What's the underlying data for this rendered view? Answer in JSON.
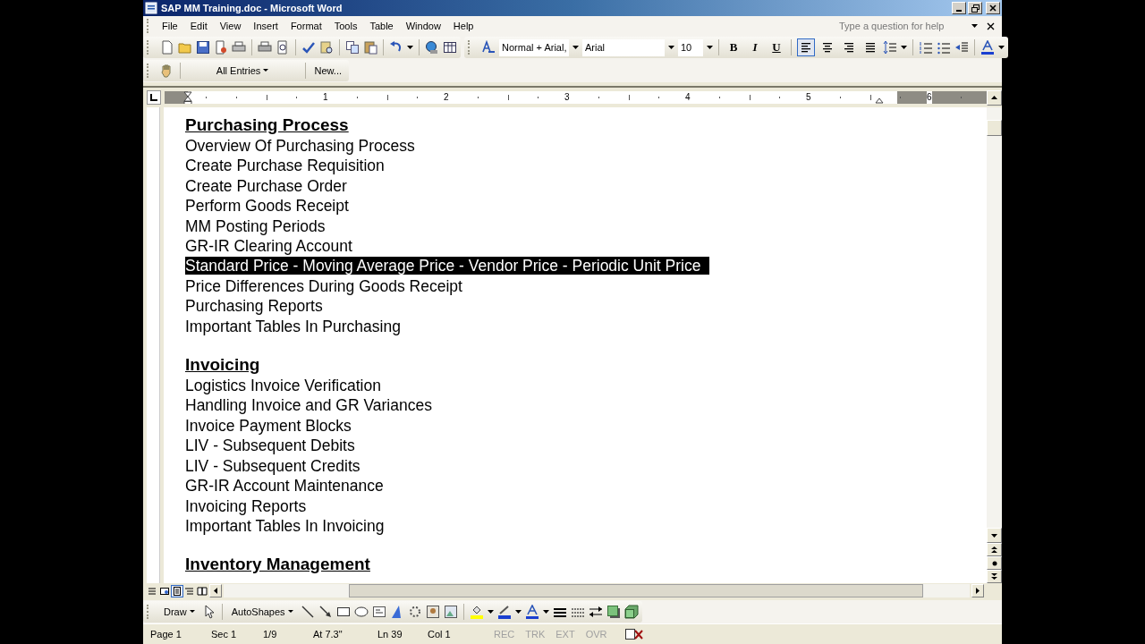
{
  "window": {
    "title": "SAP MM Training.doc - Microsoft Word"
  },
  "menu": [
    "File",
    "Edit",
    "View",
    "Insert",
    "Format",
    "Tools",
    "Table",
    "Window",
    "Help"
  ],
  "help_box": {
    "placeholder": "Type a question for help"
  },
  "formatting": {
    "style": "Normal + Arial,",
    "font": "Arial",
    "size": "10",
    "text_buttons": [
      {
        "label": "B",
        "kind": "bold",
        "selected": false
      },
      {
        "label": "I",
        "kind": "italic",
        "selected": false
      },
      {
        "label": "U",
        "kind": "underline",
        "selected": false
      }
    ],
    "align_buttons": [
      {
        "kind": "left",
        "selected": true
      },
      {
        "kind": "center",
        "selected": false
      },
      {
        "kind": "right",
        "selected": false
      },
      {
        "kind": "justify",
        "selected": false
      }
    ]
  },
  "autotext_toolbar": {
    "entries": "All Entries",
    "new_button": "New..."
  },
  "ruler": {
    "numbers": [
      "1",
      "2",
      "3",
      "4",
      "5",
      "6"
    ]
  },
  "document": {
    "sections": [
      {
        "heading": "Purchasing Process",
        "items": [
          {
            "text": "Overview Of Purchasing Process",
            "selected": false
          },
          {
            "text": "Create Purchase Requisition",
            "selected": false
          },
          {
            "text": "Create Purchase Order",
            "selected": false
          },
          {
            "text": "Perform Goods Receipt",
            "selected": false
          },
          {
            "text": "MM Posting Periods",
            "selected": false
          },
          {
            "text": "GR-IR Clearing Account",
            "selected": false
          },
          {
            "text": "Standard Price - Moving Average Price - Vendor Price - Periodic Unit Price",
            "selected": true
          },
          {
            "text": "Price Differences During Goods Receipt",
            "selected": false
          },
          {
            "text": "Purchasing Reports",
            "selected": false
          },
          {
            "text": "Important Tables In Purchasing",
            "selected": false
          }
        ]
      },
      {
        "heading": "Invoicing",
        "items": [
          {
            "text": "Logistics Invoice Verification",
            "selected": false
          },
          {
            "text": "Handling Invoice and GR Variances",
            "selected": false
          },
          {
            "text": "Invoice Payment Blocks",
            "selected": false
          },
          {
            "text": "LIV - Subsequent Debits",
            "selected": false
          },
          {
            "text": "LIV - Subsequent Credits",
            "selected": false
          },
          {
            "text": "GR-IR Account Maintenance",
            "selected": false
          },
          {
            "text": "Invoicing Reports",
            "selected": false
          },
          {
            "text": "Important Tables In Invoicing",
            "selected": false
          }
        ]
      },
      {
        "heading": "Inventory Management"
      }
    ]
  },
  "drawing_toolbar": {
    "draw_menu": "Draw",
    "autoshapes_menu": "AutoShapes"
  },
  "status_bar": {
    "fields": [
      {
        "text": "Page 1",
        "disabled": false
      },
      {
        "text": "Sec 1",
        "disabled": false
      },
      {
        "text": "1/9",
        "disabled": false
      },
      {
        "text": "At 7.3\"",
        "disabled": false
      },
      {
        "text": "Ln 39",
        "disabled": false
      },
      {
        "text": "Col 1",
        "disabled": false
      }
    ],
    "modes": [
      {
        "text": "REC",
        "disabled": true
      },
      {
        "text": "TRK",
        "disabled": true
      },
      {
        "text": "EXT",
        "disabled": true
      },
      {
        "text": "OVR",
        "disabled": true
      }
    ]
  }
}
